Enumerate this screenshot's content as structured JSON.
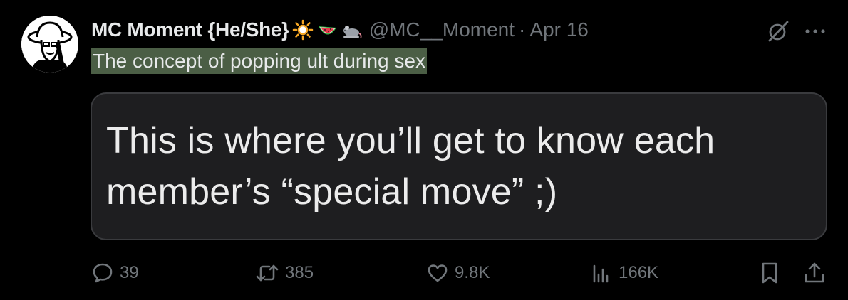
{
  "author": {
    "display_name": "MC Moment {He/She}",
    "handle": "@MC__Moment",
    "separator": "·",
    "date": "Apr 16",
    "name_emojis": [
      "sun-emoji",
      "watermelon-emoji",
      "rat-emoji"
    ]
  },
  "tweet": {
    "text": "The concept of popping ult during sex",
    "highlight_color": "#4b5e45"
  },
  "quote": {
    "text": "This is where you’ll get to know each\nmember’s “special move” ;)"
  },
  "actions": {
    "replies": "39",
    "reposts": "385",
    "likes": "9.8K",
    "views": "166K"
  },
  "icons": {
    "top_right": [
      "grok-icon",
      "more-options-icon"
    ],
    "action_bar": [
      "reply-icon",
      "repost-icon",
      "like-icon",
      "views-icon",
      "bookmark-icon",
      "share-icon"
    ]
  },
  "colors": {
    "background": "#000000",
    "text_primary": "#e7e9ea",
    "text_secondary": "#71767b",
    "card_background": "#1e1e20",
    "card_border": "#3a3b3e"
  }
}
